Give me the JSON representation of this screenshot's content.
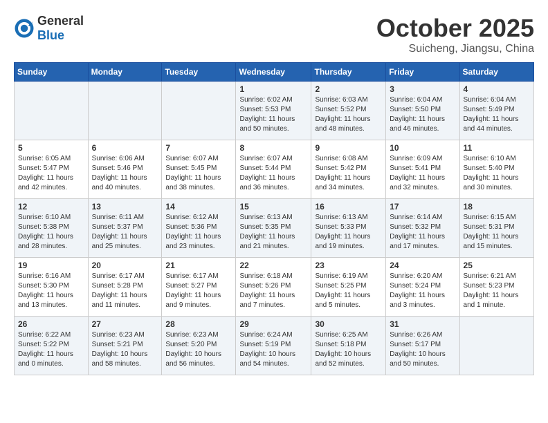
{
  "header": {
    "logo_general": "General",
    "logo_blue": "Blue",
    "month_title": "October 2025",
    "subtitle": "Suicheng, Jiangsu, China"
  },
  "weekdays": [
    "Sunday",
    "Monday",
    "Tuesday",
    "Wednesday",
    "Thursday",
    "Friday",
    "Saturday"
  ],
  "weeks": [
    [
      {
        "day": "",
        "info": ""
      },
      {
        "day": "",
        "info": ""
      },
      {
        "day": "",
        "info": ""
      },
      {
        "day": "1",
        "info": "Sunrise: 6:02 AM\nSunset: 5:53 PM\nDaylight: 11 hours\nand 50 minutes."
      },
      {
        "day": "2",
        "info": "Sunrise: 6:03 AM\nSunset: 5:52 PM\nDaylight: 11 hours\nand 48 minutes."
      },
      {
        "day": "3",
        "info": "Sunrise: 6:04 AM\nSunset: 5:50 PM\nDaylight: 11 hours\nand 46 minutes."
      },
      {
        "day": "4",
        "info": "Sunrise: 6:04 AM\nSunset: 5:49 PM\nDaylight: 11 hours\nand 44 minutes."
      }
    ],
    [
      {
        "day": "5",
        "info": "Sunrise: 6:05 AM\nSunset: 5:47 PM\nDaylight: 11 hours\nand 42 minutes."
      },
      {
        "day": "6",
        "info": "Sunrise: 6:06 AM\nSunset: 5:46 PM\nDaylight: 11 hours\nand 40 minutes."
      },
      {
        "day": "7",
        "info": "Sunrise: 6:07 AM\nSunset: 5:45 PM\nDaylight: 11 hours\nand 38 minutes."
      },
      {
        "day": "8",
        "info": "Sunrise: 6:07 AM\nSunset: 5:44 PM\nDaylight: 11 hours\nand 36 minutes."
      },
      {
        "day": "9",
        "info": "Sunrise: 6:08 AM\nSunset: 5:42 PM\nDaylight: 11 hours\nand 34 minutes."
      },
      {
        "day": "10",
        "info": "Sunrise: 6:09 AM\nSunset: 5:41 PM\nDaylight: 11 hours\nand 32 minutes."
      },
      {
        "day": "11",
        "info": "Sunrise: 6:10 AM\nSunset: 5:40 PM\nDaylight: 11 hours\nand 30 minutes."
      }
    ],
    [
      {
        "day": "12",
        "info": "Sunrise: 6:10 AM\nSunset: 5:38 PM\nDaylight: 11 hours\nand 28 minutes."
      },
      {
        "day": "13",
        "info": "Sunrise: 6:11 AM\nSunset: 5:37 PM\nDaylight: 11 hours\nand 25 minutes."
      },
      {
        "day": "14",
        "info": "Sunrise: 6:12 AM\nSunset: 5:36 PM\nDaylight: 11 hours\nand 23 minutes."
      },
      {
        "day": "15",
        "info": "Sunrise: 6:13 AM\nSunset: 5:35 PM\nDaylight: 11 hours\nand 21 minutes."
      },
      {
        "day": "16",
        "info": "Sunrise: 6:13 AM\nSunset: 5:33 PM\nDaylight: 11 hours\nand 19 minutes."
      },
      {
        "day": "17",
        "info": "Sunrise: 6:14 AM\nSunset: 5:32 PM\nDaylight: 11 hours\nand 17 minutes."
      },
      {
        "day": "18",
        "info": "Sunrise: 6:15 AM\nSunset: 5:31 PM\nDaylight: 11 hours\nand 15 minutes."
      }
    ],
    [
      {
        "day": "19",
        "info": "Sunrise: 6:16 AM\nSunset: 5:30 PM\nDaylight: 11 hours\nand 13 minutes."
      },
      {
        "day": "20",
        "info": "Sunrise: 6:17 AM\nSunset: 5:28 PM\nDaylight: 11 hours\nand 11 minutes."
      },
      {
        "day": "21",
        "info": "Sunrise: 6:17 AM\nSunset: 5:27 PM\nDaylight: 11 hours\nand 9 minutes."
      },
      {
        "day": "22",
        "info": "Sunrise: 6:18 AM\nSunset: 5:26 PM\nDaylight: 11 hours\nand 7 minutes."
      },
      {
        "day": "23",
        "info": "Sunrise: 6:19 AM\nSunset: 5:25 PM\nDaylight: 11 hours\nand 5 minutes."
      },
      {
        "day": "24",
        "info": "Sunrise: 6:20 AM\nSunset: 5:24 PM\nDaylight: 11 hours\nand 3 minutes."
      },
      {
        "day": "25",
        "info": "Sunrise: 6:21 AM\nSunset: 5:23 PM\nDaylight: 11 hours\nand 1 minute."
      }
    ],
    [
      {
        "day": "26",
        "info": "Sunrise: 6:22 AM\nSunset: 5:22 PM\nDaylight: 11 hours\nand 0 minutes."
      },
      {
        "day": "27",
        "info": "Sunrise: 6:23 AM\nSunset: 5:21 PM\nDaylight: 10 hours\nand 58 minutes."
      },
      {
        "day": "28",
        "info": "Sunrise: 6:23 AM\nSunset: 5:20 PM\nDaylight: 10 hours\nand 56 minutes."
      },
      {
        "day": "29",
        "info": "Sunrise: 6:24 AM\nSunset: 5:19 PM\nDaylight: 10 hours\nand 54 minutes."
      },
      {
        "day": "30",
        "info": "Sunrise: 6:25 AM\nSunset: 5:18 PM\nDaylight: 10 hours\nand 52 minutes."
      },
      {
        "day": "31",
        "info": "Sunrise: 6:26 AM\nSunset: 5:17 PM\nDaylight: 10 hours\nand 50 minutes."
      },
      {
        "day": "",
        "info": ""
      }
    ]
  ]
}
